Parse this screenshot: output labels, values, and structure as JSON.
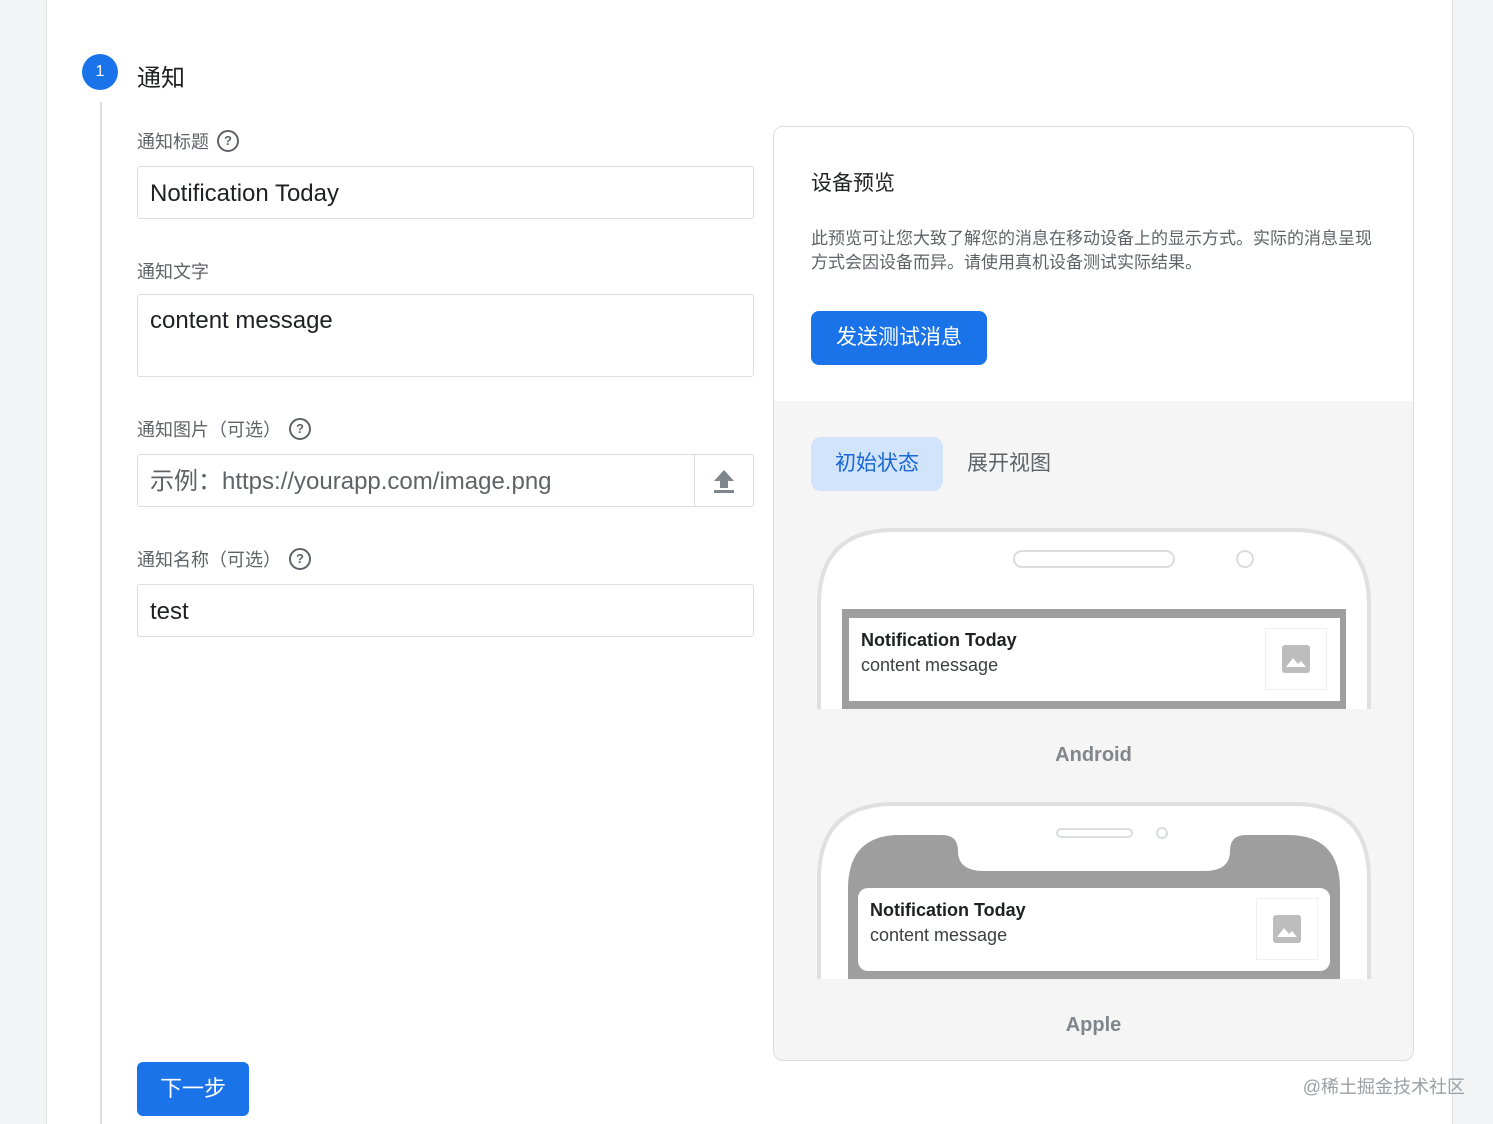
{
  "step": {
    "number": "1",
    "title": "通知"
  },
  "fields": {
    "title": {
      "label": "通知标题",
      "value": "Notification Today"
    },
    "text": {
      "label": "通知文字",
      "value": "content message"
    },
    "image": {
      "label": "通知图片（可选）",
      "placeholder": "示例：https://yourapp.com/image.png"
    },
    "name": {
      "label": "通知名称（可选）",
      "value": "test"
    }
  },
  "next_button": "下一步",
  "preview": {
    "title": "设备预览",
    "description": "此预览可让您大致了解您的消息在移动设备上的显示方式。实际的消息呈现方式会因设备而异。请使用真机设备测试实际结果。",
    "send_button": "发送测试消息",
    "tabs": [
      {
        "label": "初始状态",
        "active": true
      },
      {
        "label": "展开视图",
        "active": false
      }
    ],
    "android": {
      "label": "Android",
      "notif_title": "Notification Today",
      "notif_body": "content message"
    },
    "apple": {
      "label": "Apple",
      "notif_title": "Notification Today",
      "notif_body": "content message"
    }
  },
  "icons": {
    "help": "question-circle-icon",
    "upload": "upload-icon",
    "image": "image-placeholder-icon"
  },
  "help_glyph": "?",
  "watermark": "@稀土掘金技术社区",
  "colors": {
    "accent": "#1a73e8",
    "tab_active_bg": "#d2e3fc"
  }
}
